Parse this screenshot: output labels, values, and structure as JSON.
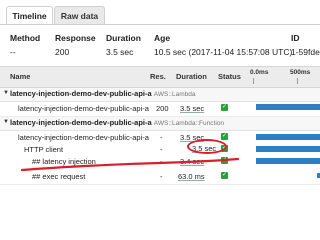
{
  "tabs": {
    "timeline": "Timeline",
    "raw_data": "Raw data"
  },
  "summary": {
    "method_label": "Method",
    "method_value": "--",
    "response_label": "Response",
    "response_value": "200",
    "duration_label": "Duration",
    "duration_value": "3.5 sec",
    "age_label": "Age",
    "age_value": "10.5 sec (2017-11-04 15:57:08 UTC)",
    "id_label": "ID",
    "id_value": "1-59fde"
  },
  "trace_header": {
    "name": "Name",
    "res": "Res.",
    "duration": "Duration",
    "status": "Status",
    "axis_left": "0.0ms",
    "axis_right": "500ms"
  },
  "groups": [
    {
      "title": "latency-injection-demo-dev-public-api-a",
      "subtitle": "AWS::Lambda",
      "rows": [
        {
          "name": "latency-injection-demo-dev-public-api-a",
          "res": "200",
          "duration": "3.5 sec"
        }
      ]
    },
    {
      "title": "latency-injection-demo-dev-public-api-a",
      "subtitle": "AWS::Lambda::Function",
      "rows": [
        {
          "name": "latency-injection-demo-dev-public-api-a",
          "res": "-",
          "duration": "3.5 sec"
        },
        {
          "name": "HTTP client",
          "res": "-",
          "duration": "3.5 sec"
        },
        {
          "name": "## latency injection",
          "res": "-",
          "duration": "3.4 sec"
        },
        {
          "name": "## exec request",
          "res": "-",
          "duration": "63.0 ms"
        }
      ]
    }
  ],
  "colors": {
    "bar": "#2e7fc3",
    "status_ok": "#2c9f3c",
    "annotation": "#d81f2b"
  }
}
